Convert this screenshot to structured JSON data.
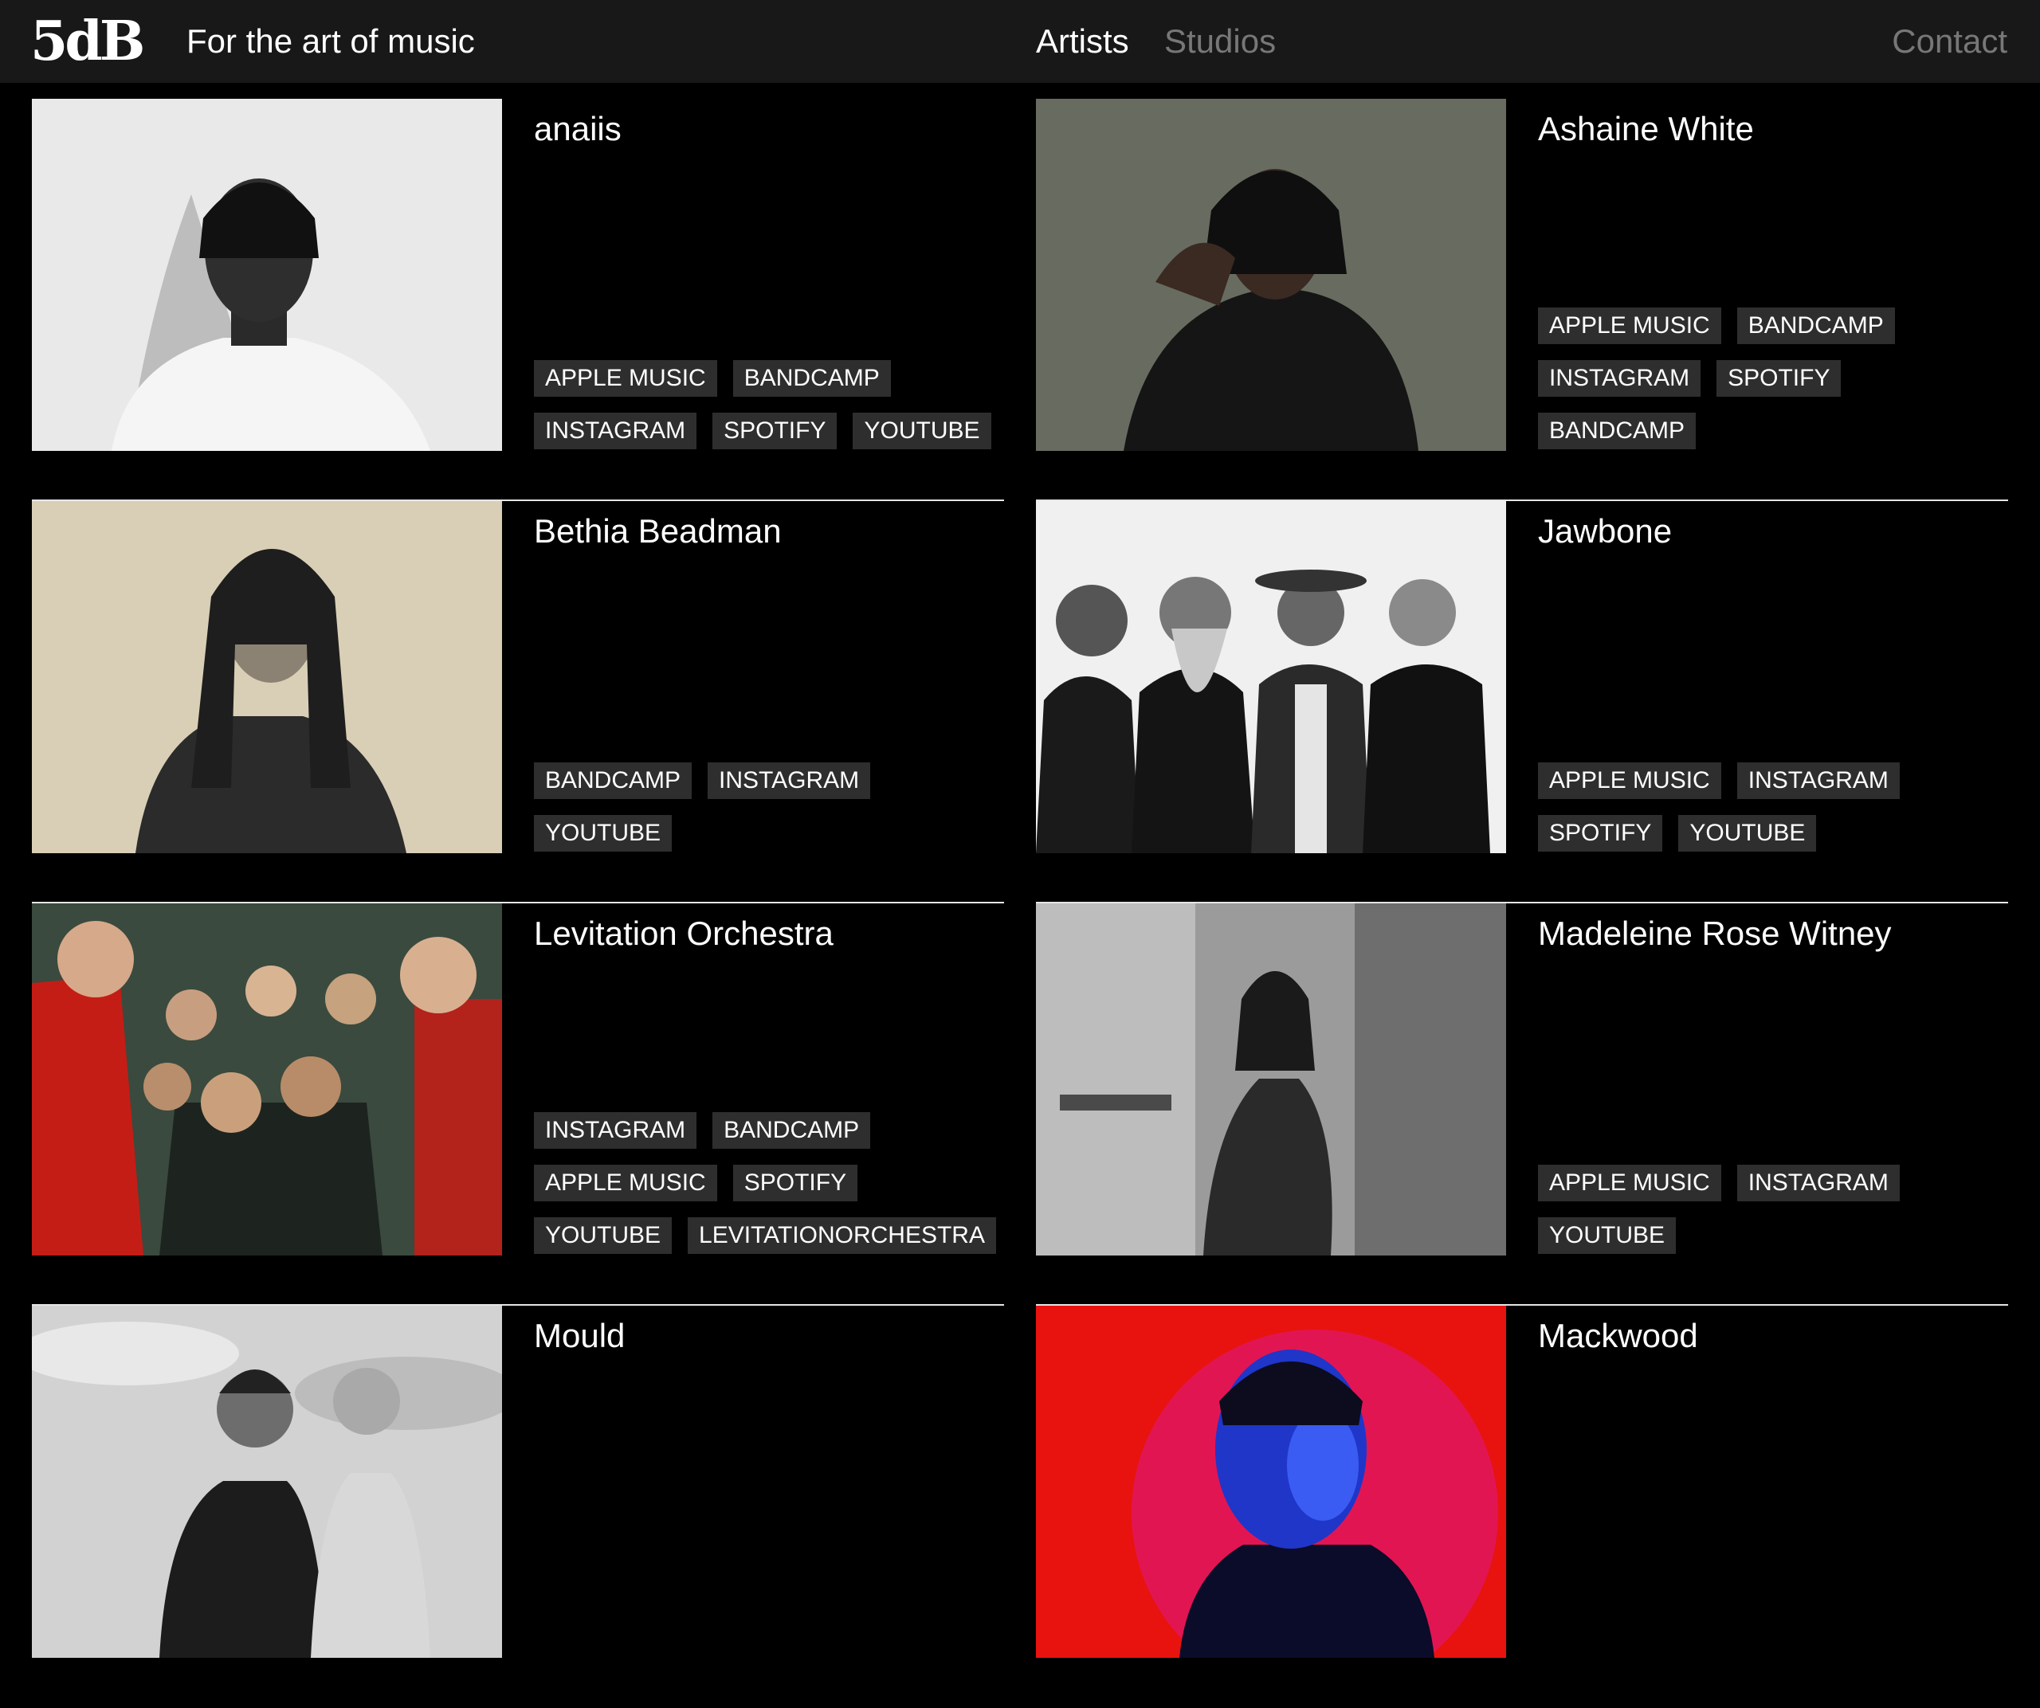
{
  "header": {
    "logo_text": "5dB",
    "tagline": "For the art of music",
    "nav": {
      "artists": "Artists",
      "studios": "Studios",
      "contact": "Contact"
    }
  },
  "artists": [
    {
      "name": "anaiis",
      "tags": [
        "APPLE MUSIC",
        "BANDCAMP",
        "INSTAGRAM",
        "SPOTIFY",
        "YOUTUBE"
      ]
    },
    {
      "name": "Ashaine White",
      "tags": [
        "APPLE MUSIC",
        "BANDCAMP",
        "INSTAGRAM",
        "SPOTIFY",
        "BANDCAMP"
      ]
    },
    {
      "name": "Bethia Beadman",
      "tags": [
        "BANDCAMP",
        "INSTAGRAM",
        "YOUTUBE"
      ]
    },
    {
      "name": "Jawbone",
      "tags": [
        "APPLE MUSIC",
        "INSTAGRAM",
        "SPOTIFY",
        "YOUTUBE"
      ]
    },
    {
      "name": "Levitation Orchestra",
      "tags": [
        "INSTAGRAM",
        "BANDCAMP",
        "APPLE MUSIC",
        "SPOTIFY",
        "YOUTUBE",
        "LEVITATIONORCHESTRA"
      ]
    },
    {
      "name": "Madeleine Rose Witney",
      "tags": [
        "APPLE MUSIC",
        "INSTAGRAM",
        "YOUTUBE"
      ]
    },
    {
      "name": "Mould",
      "tags": []
    },
    {
      "name": "Mackwood",
      "tags": []
    }
  ],
  "colors": {
    "header_bg": "#181818",
    "page_bg": "#000000",
    "tag_bg": "#2e2e2e",
    "muted_nav": "#777777"
  }
}
